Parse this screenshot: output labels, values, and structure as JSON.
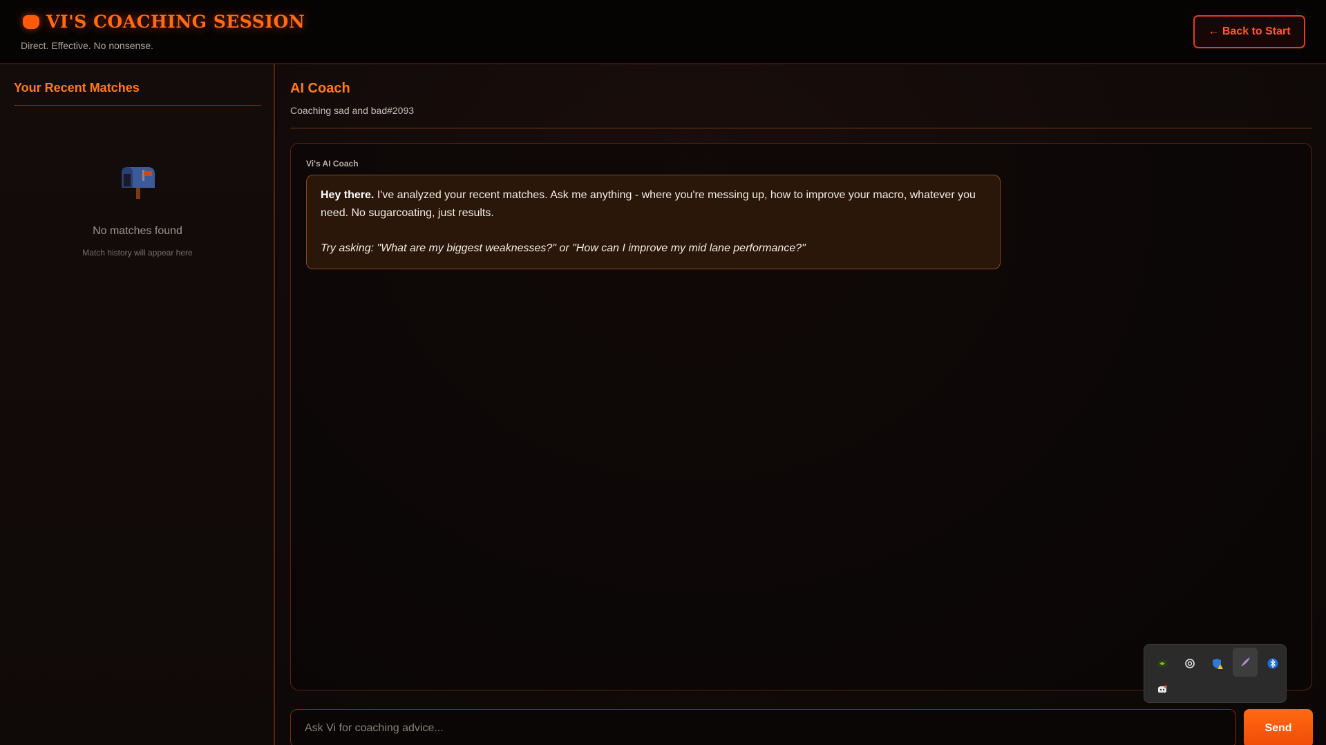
{
  "header": {
    "brand_icon": "fist-icon",
    "title": "VI'S COACHING SESSION",
    "tagline": "Direct. Effective. No nonsense.",
    "back_button": "← Back to Start"
  },
  "sidebar": {
    "title": "Your Recent Matches",
    "empty_icon": "mailbox-icon",
    "empty_title": "No matches found",
    "empty_subtitle": "Match history will appear here"
  },
  "main": {
    "title": "AI Coach",
    "subtitle": "Coaching sad and bad#2093",
    "message": {
      "sender": "Vi's AI Coach",
      "greeting": "Hey there.",
      "body": " I've analyzed your recent matches. Ask me anything - where you're messing up, how to improve your macro, whatever you need. No sugarcoating, just results.",
      "tip": "Try asking: \"What are my biggest weaknesses?\" or \"How can I improve my mid lane performance?\""
    }
  },
  "input": {
    "placeholder": "Ask Vi for coaching advice...",
    "value": "",
    "send_label": "Send"
  },
  "tray": {
    "icons": [
      "nvidia-icon",
      "copilot-icon",
      "security-warning-icon",
      "feather-icon",
      "bluetooth-icon",
      "discord-icon"
    ]
  },
  "colors": {
    "accent": "#ff6a12",
    "accent_red": "#e0401a",
    "background": "#0d0807",
    "bubble": "#2a170a"
  }
}
